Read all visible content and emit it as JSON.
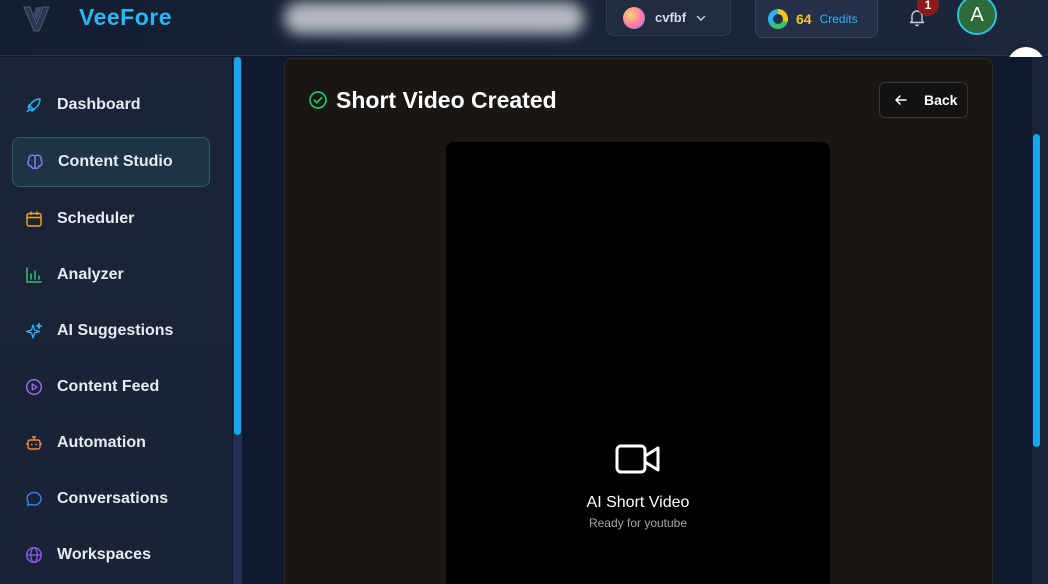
{
  "header": {
    "brand": "VeeFore",
    "workspace_name": "cvfbf",
    "credits_count": "64",
    "credits_label": "Credits",
    "notification_count": "1",
    "avatar_initial": "A"
  },
  "sidebar": {
    "items": [
      {
        "label": "Dashboard",
        "icon": "rocket-icon",
        "color": "#29b6f6"
      },
      {
        "label": "Content Studio",
        "icon": "brain-icon",
        "color": "#8b7cf6",
        "active": true
      },
      {
        "label": "Scheduler",
        "icon": "calendar-icon",
        "color": "#f5a623"
      },
      {
        "label": "Analyzer",
        "icon": "bar-chart-icon",
        "color": "#36c26b"
      },
      {
        "label": "AI Suggestions",
        "icon": "sparkles-icon",
        "color": "#29b6f6"
      },
      {
        "label": "Content Feed",
        "icon": "play-circle-icon",
        "color": "#a46cf0"
      },
      {
        "label": "Automation",
        "icon": "bot-icon",
        "color": "#f08a3c"
      },
      {
        "label": "Conversations",
        "icon": "chat-icon",
        "color": "#3b82f6"
      },
      {
        "label": "Workspaces",
        "icon": "globe-icon",
        "color": "#8b5cf6"
      }
    ]
  },
  "main": {
    "title": "Short Video Created",
    "back_label": "Back",
    "video_title": "AI Short Video",
    "video_subtitle": "Ready for youtube"
  },
  "colors": {
    "accent": "#29b6f6",
    "success": "#22c55e",
    "credits": "#f5c518"
  }
}
